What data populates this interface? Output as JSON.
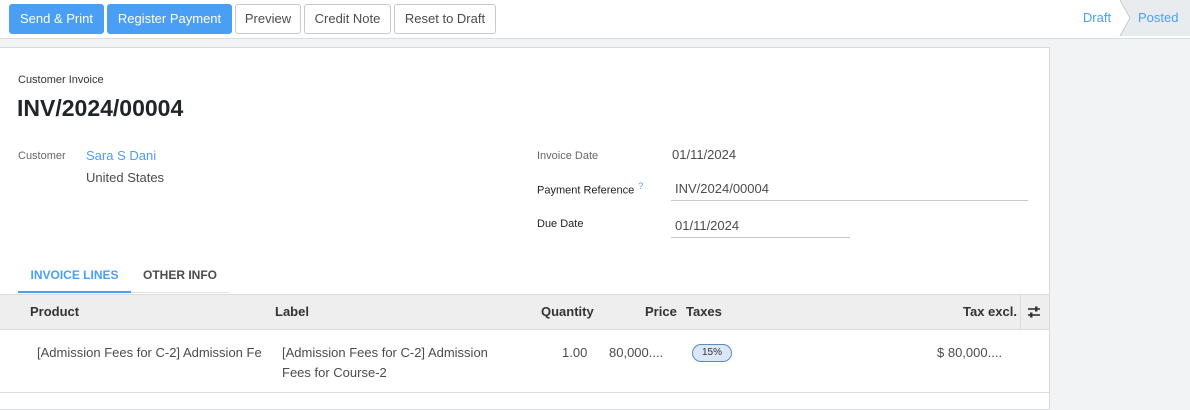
{
  "toolbar": {
    "send_print": "Send & Print",
    "register_payment": "Register Payment",
    "preview": "Preview",
    "credit_note": "Credit Note",
    "reset_to_draft": "Reset to Draft"
  },
  "statusbar": {
    "draft": "Draft",
    "posted": "Posted",
    "active": "Posted"
  },
  "invoice": {
    "type": "Customer Invoice",
    "name": "INV/2024/00004"
  },
  "fields": {
    "customer_label": "Customer",
    "customer_name": "Sara S Dani",
    "customer_country": "United States",
    "invoice_date_label": "Invoice Date",
    "invoice_date": "01/11/2024",
    "payment_reference_label": "Payment Reference",
    "payment_reference_help": "?",
    "payment_reference": "INV/2024/00004",
    "due_date_label": "Due Date",
    "due_date": "01/11/2024"
  },
  "tabs": [
    {
      "label": "INVOICE LINES",
      "active": true
    },
    {
      "label": "OTHER INFO",
      "active": false
    }
  ],
  "table": {
    "columns": [
      "Product",
      "Label",
      "Quantity",
      "Price",
      "Taxes",
      "Tax excl."
    ],
    "rows": [
      {
        "product": "[Admission Fees for C-2] Admission Fe",
        "label_line1": "[Admission Fees for C-2] Admission",
        "label_line2": "Fees for Course-2",
        "quantity": "1.00",
        "price": "80,000....",
        "taxes": "15%",
        "tax_excl": "$ 80,000...."
      }
    ]
  },
  "colors": {
    "primary": "#4a9ff5",
    "text": "#4c4c4c",
    "header_bg": "#eeeeee"
  },
  "icons": {
    "optional_columns": "settings-sliders-icon"
  }
}
